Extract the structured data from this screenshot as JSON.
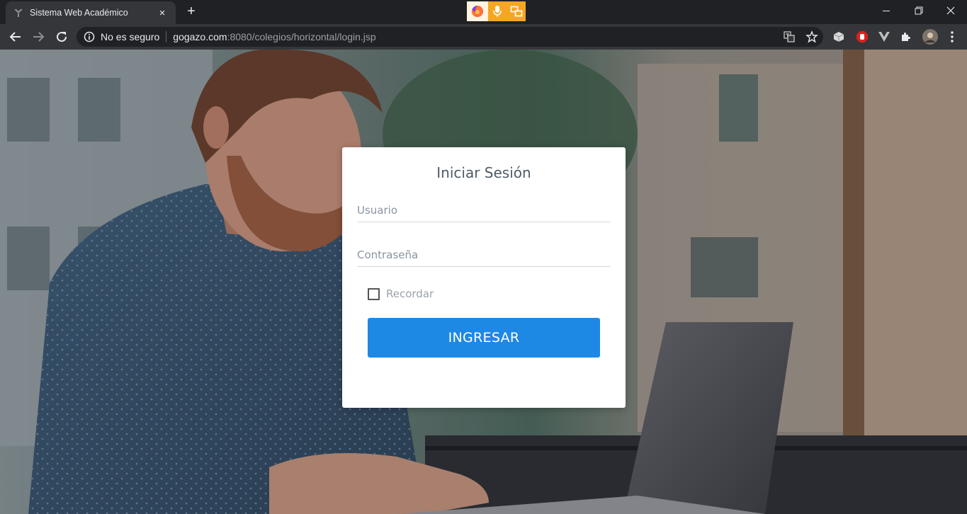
{
  "browser": {
    "tab": {
      "title": "Sistema Web Académico",
      "close": "×"
    },
    "new_tab": "+",
    "address": {
      "security_text": "No es seguro",
      "url_host": "gogazo.com",
      "url_rest": ":8080/colegios/horizontal/login.jsp"
    },
    "colors": {
      "frame": "#202124",
      "toolbar": "#35363a",
      "extension_accent": "#f5a623"
    }
  },
  "login": {
    "title": "Iniciar Sesión",
    "username_placeholder": "Usuario",
    "password_placeholder": "Contraseña",
    "remember_label": "Recordar",
    "remember_checked": false,
    "submit_label": "INGRESAR",
    "colors": {
      "button": "#1e88e5",
      "title": "#4f5b66"
    }
  },
  "background": {
    "description_icon": "background-photo"
  }
}
